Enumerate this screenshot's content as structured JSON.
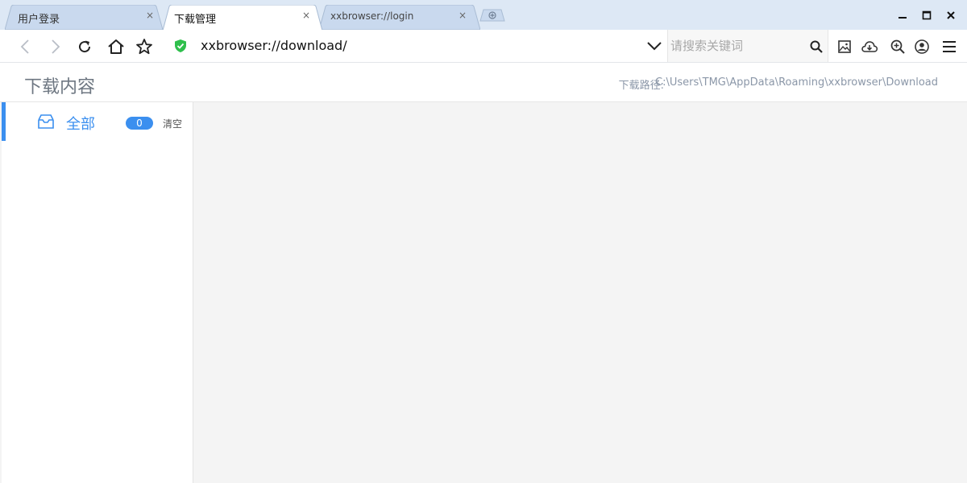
{
  "tabs": [
    {
      "label": "用户登录",
      "active": false
    },
    {
      "label": "下载管理",
      "active": true
    },
    {
      "label": "xxbrowser://login",
      "active": false
    }
  ],
  "tab_close_glyph": "×",
  "toolbar": {
    "url": "xxbrowser://download/",
    "search_placeholder": "请搜索关键词"
  },
  "page": {
    "title": "下载内容",
    "path_label": "下载路径:",
    "path_value": "C:\\Users\\TMG\\AppData\\Roaming\\xxbrowser\\Download"
  },
  "sidebar": {
    "items": [
      {
        "label": "全部",
        "count": "0",
        "icon": "inbox-icon"
      }
    ],
    "clear_label": "清空"
  },
  "colors": {
    "accent": "#3b8fef",
    "tabstrip_bg": "#dde8f5",
    "page_bg": "#f4f4f4",
    "secure_green": "#2fbf4c"
  }
}
